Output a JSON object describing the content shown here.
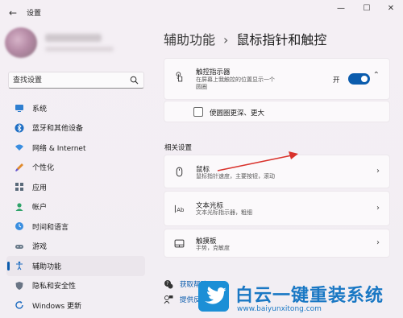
{
  "window": {
    "title": "设置",
    "back_icon": "arrow-left-icon"
  },
  "search": {
    "placeholder": "查找设置"
  },
  "nav": {
    "items": [
      {
        "label": "系统",
        "icon": "monitor-icon"
      },
      {
        "label": "蓝牙和其他设备",
        "icon": "bluetooth-icon"
      },
      {
        "label": "网络 & Internet",
        "icon": "wifi-icon"
      },
      {
        "label": "个性化",
        "icon": "brush-icon"
      },
      {
        "label": "应用",
        "icon": "apps-icon"
      },
      {
        "label": "帐户",
        "icon": "person-icon"
      },
      {
        "label": "时间和语言",
        "icon": "globe-clock-icon"
      },
      {
        "label": "游戏",
        "icon": "gamepad-icon"
      },
      {
        "label": "辅助功能",
        "icon": "accessibility-icon"
      },
      {
        "label": "隐私和安全性",
        "icon": "shield-icon"
      },
      {
        "label": "Windows 更新",
        "icon": "update-icon"
      }
    ],
    "active_index": 8
  },
  "breadcrumb": {
    "parent": "辅助功能",
    "separator": "›",
    "current": "鼠标指针和触控"
  },
  "touch_indicator": {
    "title": "触控指示器",
    "desc_line1": "在屏幕上我触控的位置显示一个",
    "desc_line2": "圆圈",
    "toggle_label": "开",
    "toggle_on": true
  },
  "darker_circle": {
    "label": "使圆圈更深、更大",
    "checked": false
  },
  "related_settings": {
    "title": "相关设置",
    "items": [
      {
        "title": "鼠标",
        "desc": "鼠标指针速度，主要按钮，滚动",
        "icon": "mouse-icon"
      },
      {
        "title": "文本光标",
        "desc": "文本光标指示器，粗细",
        "icon": "text-cursor-icon"
      },
      {
        "title": "触摸板",
        "desc": "手势，克敏度",
        "icon": "touchpad-icon"
      }
    ]
  },
  "links": {
    "help": "获取帮助",
    "feedback": "提供反馈"
  },
  "watermark": {
    "text": "白云一键重装系统",
    "url": "www.baiyunxitong.com"
  },
  "colors": {
    "accent": "#0b5cad",
    "annotation_arrow": "#d9322c",
    "watermark": "#1a78c4"
  }
}
